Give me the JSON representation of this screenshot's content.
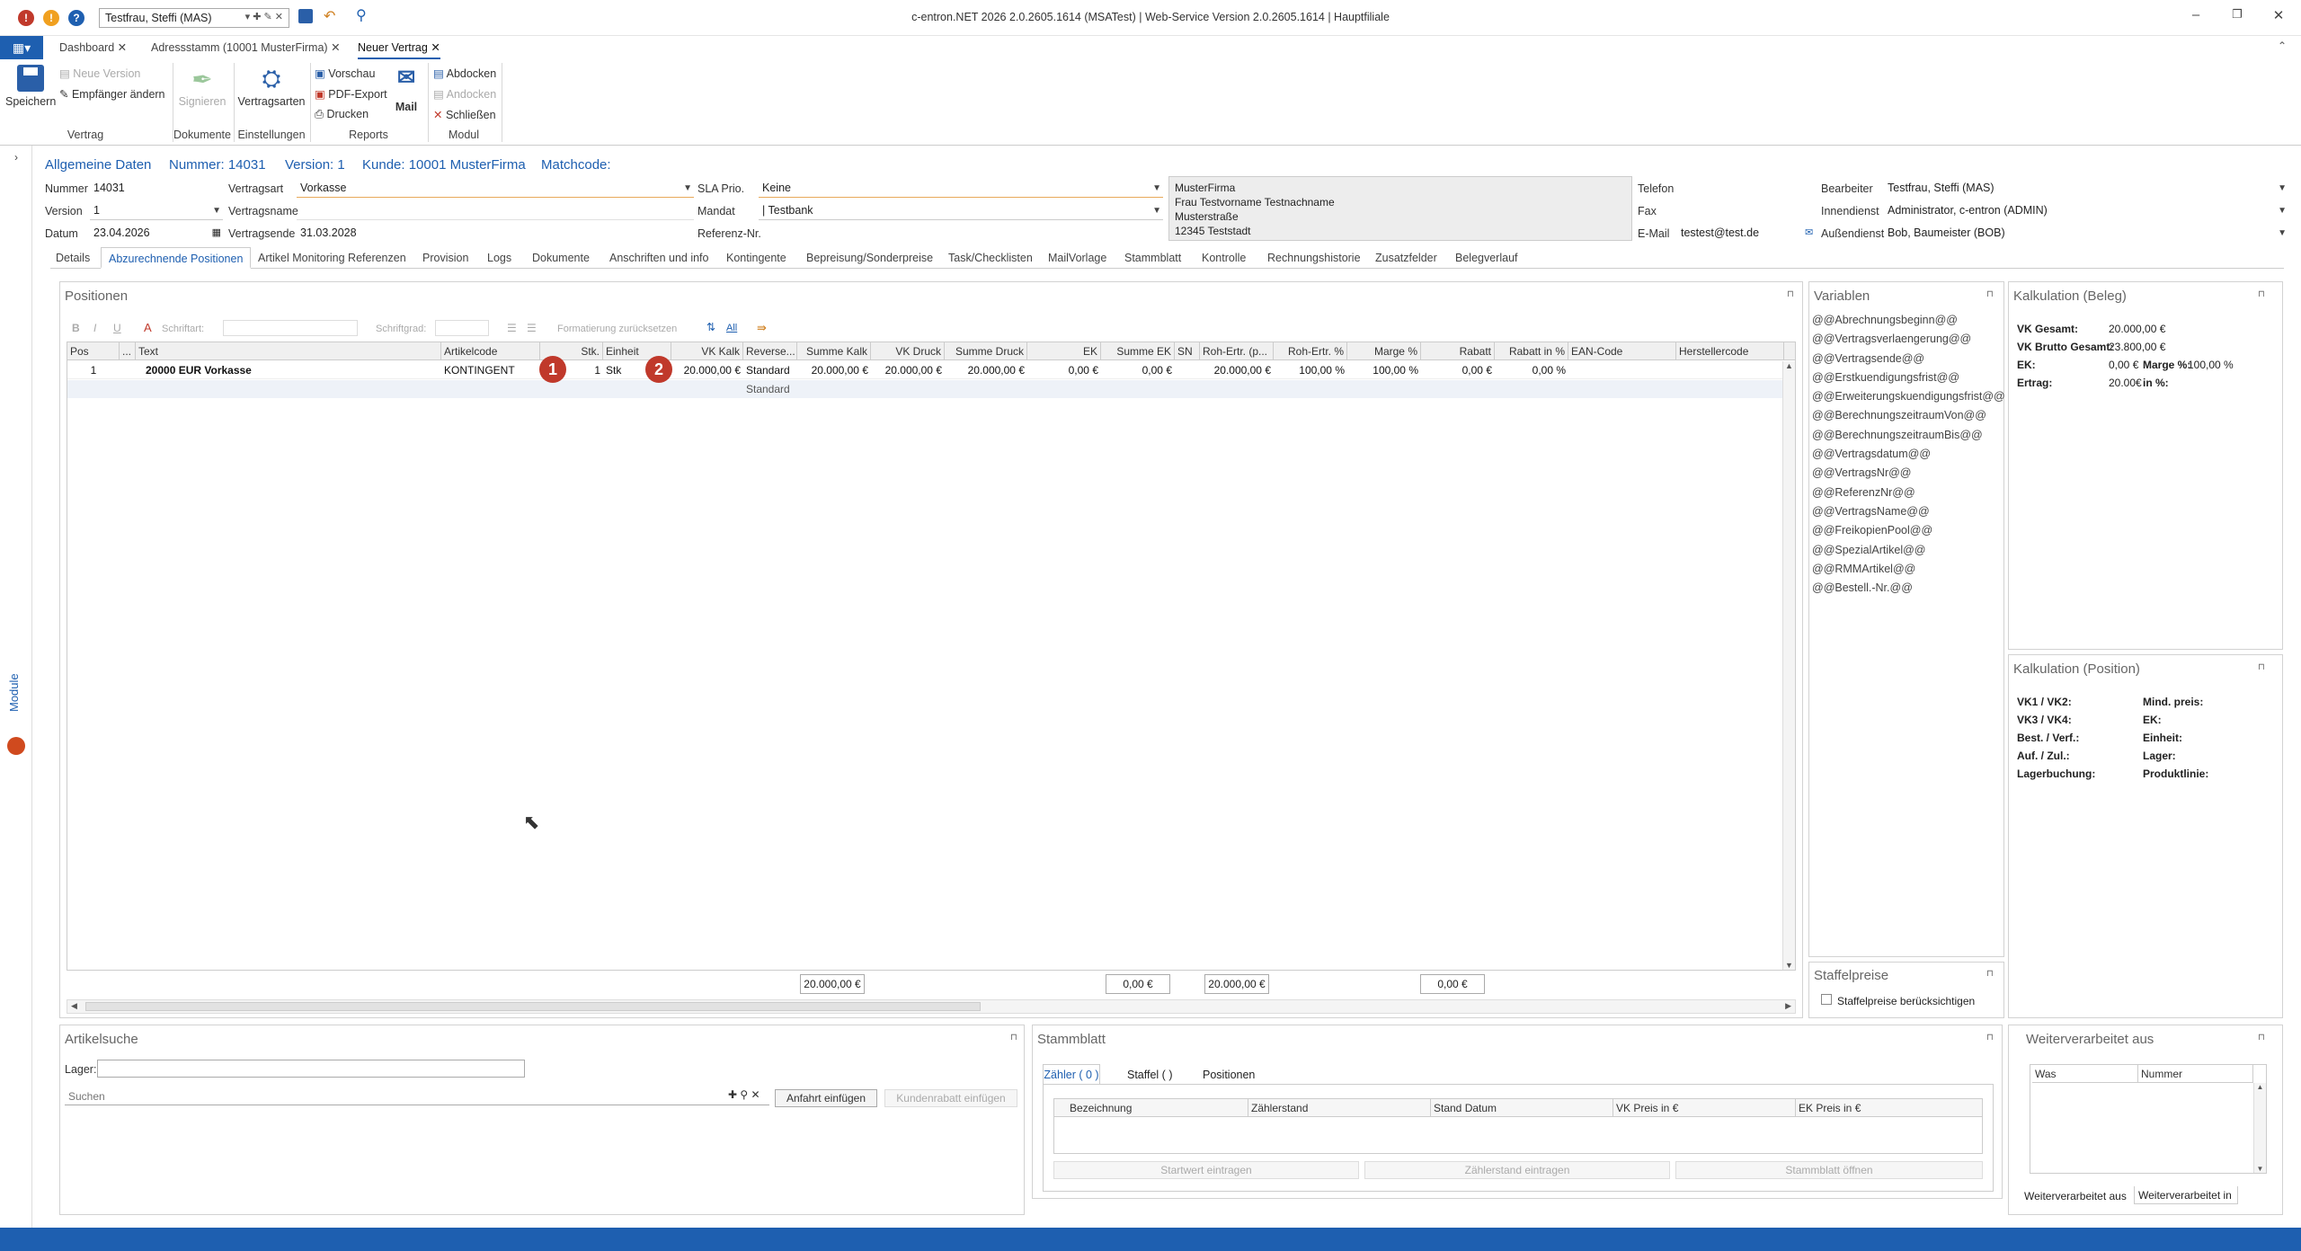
{
  "colors": {
    "accent": "#1e5fb0",
    "badge": "#c0392b",
    "input_underline": "#e8a95a"
  },
  "titlebar": {
    "user": "Testfrau, Steffi (MAS)",
    "title": "c-entron.NET 2026 2.0.2605.1614 (MSATest) | Web-Service Version 2.0.2605.1614 | Hauptfiliale"
  },
  "doc_tabs": [
    "Dashboard",
    "Adressstamm (10001 MusterFirma)",
    "Neuer Vertrag"
  ],
  "ribbon": {
    "save": "Speichern",
    "neue_version": "Neue Version",
    "empfaenger": "Empfänger ändern",
    "group_vertrag": "Vertrag",
    "signieren": "Signieren",
    "group_dokumente": "Dokumente",
    "vertragsarten": "Vertragsarten",
    "group_einstellungen": "Einstellungen",
    "vorschau": "Vorschau",
    "pdf_export": "PDF-Export",
    "drucken": "Drucken",
    "mail": "Mail",
    "group_reports": "Reports",
    "abdocken": "Abdocken",
    "andocken": "Andocken",
    "schliessen": "Schließen",
    "group_modul": "Modul"
  },
  "leftrail": {
    "module": "Module"
  },
  "header": {
    "allgemeine": "Allgemeine Daten",
    "nummer": "Nummer: 14031",
    "version": "Version: 1",
    "kunde": "Kunde: 10001 MusterFirma",
    "matchcode": "Matchcode:"
  },
  "form": {
    "nummer_label": "Nummer",
    "nummer": "14031",
    "version_label": "Version",
    "version": "1",
    "datum_label": "Datum",
    "datum": "23.04.2026",
    "vertragsart_label": "Vertragsart",
    "vertragsart": "Vorkasse",
    "vertragsname_label": "Vertragsname",
    "vertragsname": "",
    "vertragsende_label": "Vertragsende",
    "vertragsende": "31.03.2028",
    "sla_label": "SLA Prio.",
    "sla": "Keine",
    "mandat_label": "Mandat",
    "mandat": "| Testbank",
    "referenz_label": "Referenz-Nr.",
    "address": [
      "MusterFirma",
      "Frau Testvorname Testnachname",
      "Musterstraße",
      "12345 Teststadt"
    ],
    "telefon_label": "Telefon",
    "fax_label": "Fax",
    "email_label": "E-Mail",
    "email": "testest@test.de",
    "bearbeiter_label": "Bearbeiter",
    "bearbeiter": "Testfrau, Steffi (MAS)",
    "innendienst_label": "Innendienst",
    "innendienst": "Administrator, c-entron (ADMIN)",
    "aussendienst_label": "Außendienst",
    "aussendienst": "Bob, Baumeister (BOB)"
  },
  "subtabs": [
    "Details",
    "Abzurechnende Positionen",
    "Artikel Monitoring Referenzen",
    "Provision",
    "Logs",
    "Dokumente",
    "Anschriften und info",
    "Kontingente",
    "Bepreisung/Sonderpreise",
    "Task/Checklisten",
    "MailVorlage",
    "Stammblatt",
    "Kontrolle",
    "Rechnungshistorie",
    "Zusatzfelder",
    "Belegverlauf"
  ],
  "positionen": {
    "title": "Positionen",
    "toolbar": {
      "schriftart": "Schriftart:",
      "schriftgrad": "Schriftgrad:",
      "format_reset": "Formatierung zurücksetzen",
      "all": "All"
    },
    "columns": [
      "Pos",
      "...",
      "Text",
      "Artikelcode",
      "Stk.",
      "Einheit",
      "VK Kalk",
      "Reverse...",
      "Summe Kalk",
      "VK Druck",
      "Summe Druck",
      "EK",
      "Summe EK",
      "SN",
      "Roh-Ertr. (p...",
      "Roh-Ertr. %",
      "Marge %",
      "Rabatt",
      "Rabatt in %",
      "EAN-Code",
      "Herstellercode"
    ],
    "row": {
      "pos": "1",
      "text": "20000 EUR Vorkasse",
      "artikelcode": "KONTINGENT",
      "stk": "1",
      "einheit": "Stk",
      "vk_kalk": "20.000,00 €",
      "reverse": "Standard",
      "summe_kalk": "20.000,00 €",
      "vk_druck": "20.000,00 €",
      "summe_druck": "20.000,00 €",
      "ek": "0,00 €",
      "summe_ek": "0,00 €",
      "roh": "20.000,00 €",
      "roh_pct": "100,00 %",
      "marge": "100,00 %",
      "rabatt": "0,00 €",
      "rabatt_pct": "0,00 %"
    },
    "group_row": "Standard",
    "badges": [
      "1",
      "2"
    ],
    "sums": {
      "summe_kalk": "20.000,00 €",
      "summe_ek": "0,00 €",
      "roh": "20.000,00 €",
      "rabatt": "0,00 €"
    }
  },
  "variablen": {
    "title": "Variablen",
    "items": [
      "@@Abrechnungsbeginn@@",
      "@@Vertragsverlaengerung@@",
      "@@Vertragsende@@",
      "@@Erstkuendigungsfrist@@",
      "@@Erweiterungskuendigungsfrist@@",
      "@@BerechnungszeitraumVon@@",
      "@@BerechnungszeitraumBis@@",
      "@@Vertragsdatum@@",
      "@@VertragsNr@@",
      "@@ReferenzNr@@",
      "@@VertragsName@@",
      "@@FreikopienPool@@",
      "@@SpezialArtikel@@",
      "@@RMMArtikel@@",
      "@@Bestell.-Nr.@@"
    ]
  },
  "staffelpreise": {
    "title": "Staffelpreise",
    "checkbox": "Staffelpreise berücksichtigen"
  },
  "kalk_beleg": {
    "title": "Kalkulation (Beleg)",
    "vk_gesamt_l": "VK Gesamt:",
    "vk_gesamt": "20.000,00 €",
    "vk_brutto_l": "VK Brutto Gesamt:",
    "vk_brutto": "23.800,00 €",
    "ek_l": "EK:",
    "ek": "0,00 €",
    "marge_l": "Marge %:",
    "marge": "100,00 %",
    "ertrag_l": "Ertrag:",
    "ertrag": "20.00€",
    "in_pct": "in %:"
  },
  "kalk_pos": {
    "title": "Kalkulation (Position)",
    "left": [
      "VK1 / VK2:",
      "VK3 / VK4:",
      "Best. / Verf.:",
      "Auf. / Zul.:",
      "Lagerbuchung:"
    ],
    "right": [
      "Mind. preis:",
      "EK:",
      "Einheit:",
      "Lager:",
      "Produktlinie:"
    ]
  },
  "artikelsuche": {
    "title": "Artikelsuche",
    "lager": "Lager:",
    "search_placeholder": "Suchen",
    "anfahrt": "Anfahrt einfügen",
    "kundenrabatt": "Kundenrabatt einfügen"
  },
  "stammblatt": {
    "title": "Stammblatt",
    "tabs": [
      "Zähler ( 0 )",
      "Staffel ( )",
      "Positionen"
    ],
    "columns": [
      "Bezeichnung",
      "Zählerstand",
      "Stand Datum",
      "VK Preis in €",
      "EK Preis in €"
    ],
    "buttons": [
      "Startwert eintragen",
      "Zählerstand eintragen",
      "Stammblatt öffnen"
    ]
  },
  "weiterverarbeitet": {
    "title": "Weiterverarbeitet aus",
    "columns": [
      "Was",
      "Nummer"
    ],
    "tabs": [
      "Weiterverarbeitet aus",
      "Weiterverarbeitet in"
    ]
  }
}
